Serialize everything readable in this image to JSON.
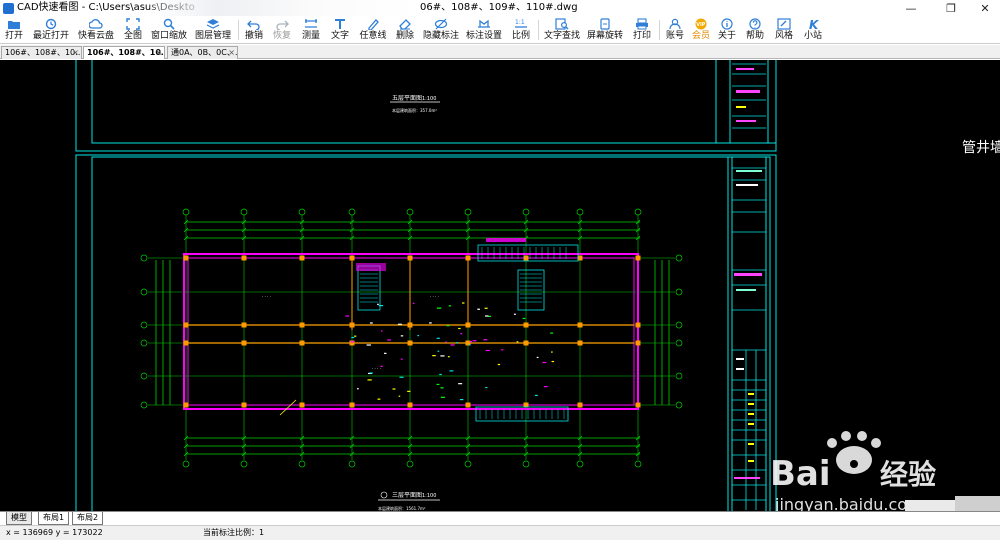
{
  "window": {
    "app_name": "CAD快速看图",
    "title_prefix": "CAD快速看图 - C:\\Users\\asus\\Deskto",
    "title_suffix": "06#、108#、109#、110#.dwg",
    "minimize": "—",
    "restore": "❐",
    "close": "✕"
  },
  "toolbar": [
    {
      "label": "打开",
      "icon": "folder-icon",
      "enabled": true
    },
    {
      "label": "最近打开",
      "icon": "history-icon",
      "enabled": true
    },
    {
      "label": "快看云盘",
      "icon": "cloud-icon",
      "enabled": true
    },
    {
      "label": "全图",
      "icon": "fullview-icon",
      "enabled": true
    },
    {
      "label": "窗口缩放",
      "icon": "window-zoom-icon",
      "enabled": true
    },
    {
      "label": "图层管理",
      "icon": "layers-icon",
      "enabled": true
    },
    {
      "label": "撤销",
      "icon": "undo-icon",
      "enabled": true
    },
    {
      "label": "恢复",
      "icon": "redo-icon",
      "enabled": false
    },
    {
      "label": "测量",
      "icon": "measure-icon",
      "enabled": true
    },
    {
      "label": "文字",
      "icon": "text-icon",
      "enabled": true
    },
    {
      "label": "任意线",
      "icon": "pen-icon",
      "enabled": true
    },
    {
      "label": "删除",
      "icon": "eraser-icon",
      "enabled": true
    },
    {
      "label": "隐藏标注",
      "icon": "hide-annotation-icon",
      "enabled": true
    },
    {
      "label": "标注设置",
      "icon": "annotation-settings-icon",
      "enabled": true
    },
    {
      "label": "比例",
      "icon": "scale-icon",
      "enabled": true
    },
    {
      "label": "文字查找",
      "icon": "text-search-icon",
      "enabled": true
    },
    {
      "label": "屏幕旋转",
      "icon": "rotate-screen-icon",
      "enabled": true
    },
    {
      "label": "打印",
      "icon": "print-icon",
      "enabled": true
    },
    {
      "label": "账号",
      "icon": "account-icon",
      "enabled": true
    },
    {
      "label": "会员",
      "icon": "vip-icon",
      "enabled": true
    },
    {
      "label": "关于",
      "icon": "info-icon",
      "enabled": true
    },
    {
      "label": "帮助",
      "icon": "help-icon",
      "enabled": true
    },
    {
      "label": "风格",
      "icon": "style-icon",
      "enabled": true
    },
    {
      "label": "小站",
      "icon": "station-icon",
      "enabled": true
    }
  ],
  "icons_text": {
    "vip": "VIP",
    "scale": "1:1",
    "station": "K"
  },
  "tabs": [
    {
      "label": "106#、108#、10…",
      "close": "×",
      "active": false
    },
    {
      "label": "106#、108#、10…",
      "close": "×",
      "active": true
    },
    {
      "label": "通0A、0B、0C、…",
      "close": "×",
      "active": false
    }
  ],
  "drawing": {
    "top_view_title": "五层平面图",
    "top_view_scale": "1:100",
    "top_view_note": "本层建筑面积：357.0m²",
    "main_view_title": "三层平面图",
    "main_view_scale": "1:100",
    "main_view_note": "本层建筑面积：1561.7m²",
    "side_text": "管井墙"
  },
  "layout_tabs": [
    {
      "label": "模型",
      "active": true
    },
    {
      "label": "布局1",
      "active": false
    },
    {
      "label": "布局2",
      "active": false
    }
  ],
  "status": {
    "coords": "x = 136969  y = 173022",
    "scale": "当前标注比例：1"
  },
  "watermark": {
    "brand": "Bai",
    "brand_cn": "经验",
    "url": "jingyan.baidu.com"
  },
  "colors": {
    "canvas_bg": "#000000",
    "frame": "#00e5e5",
    "grid": "#00d000",
    "wall": "#ff00ff",
    "column": "#ff9900",
    "accent_blue": "#1e6fd0"
  }
}
